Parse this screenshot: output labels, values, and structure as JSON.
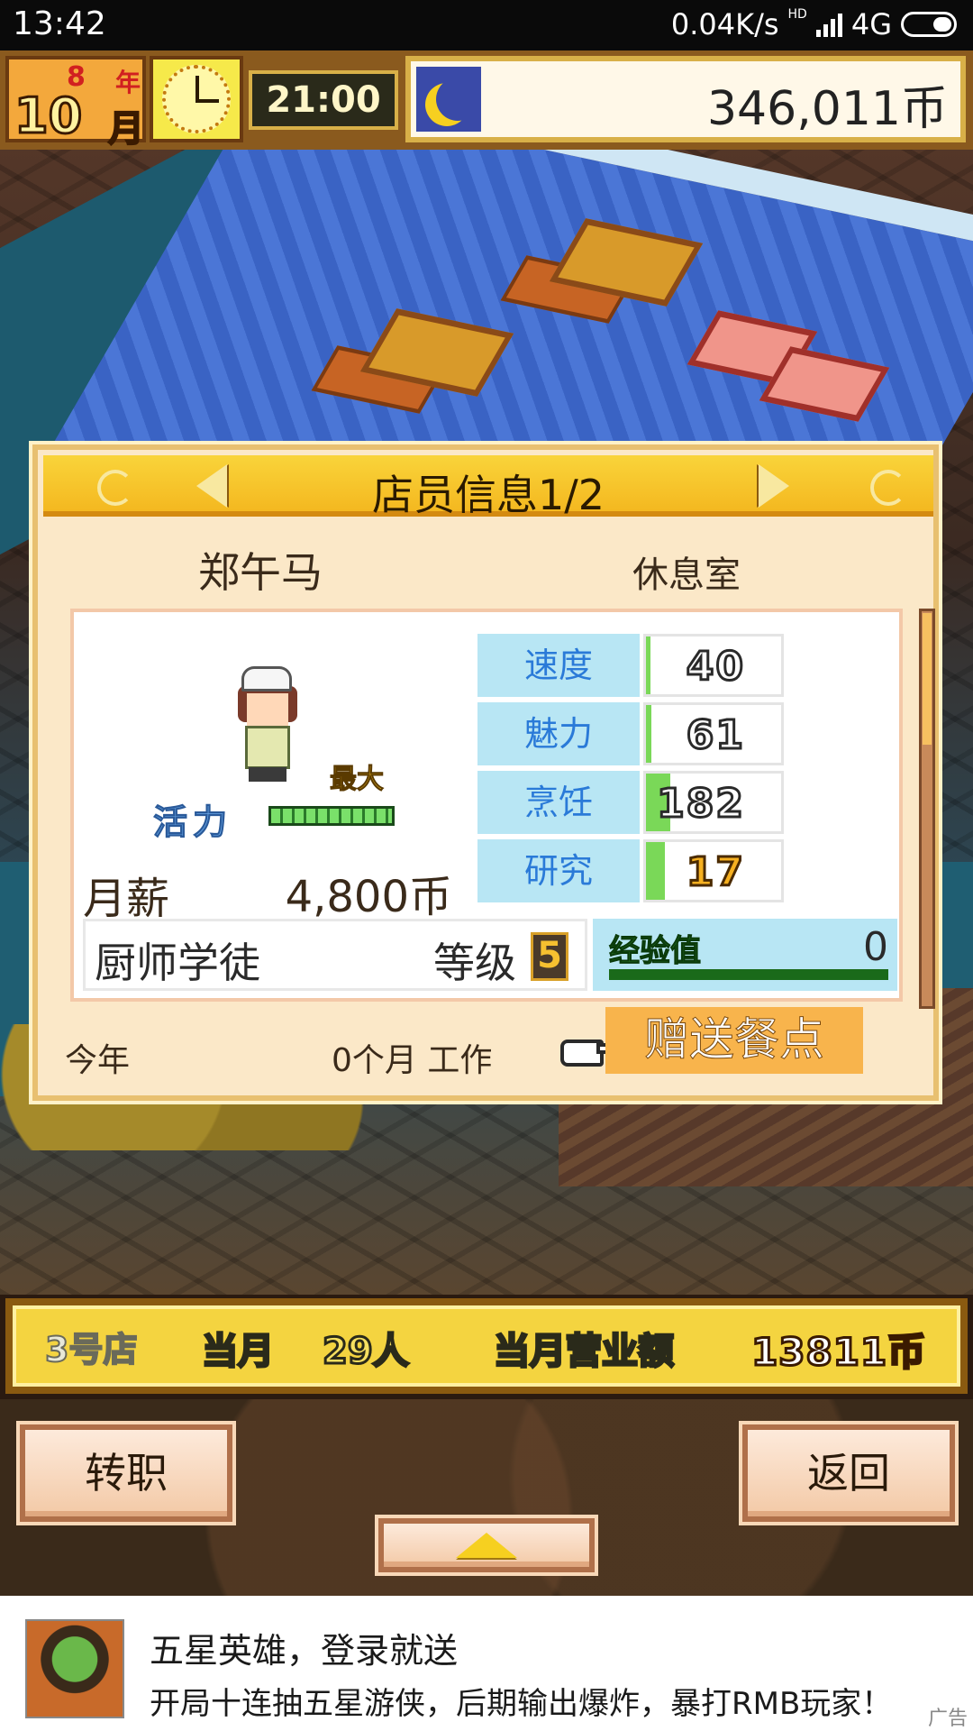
{
  "status_bar": {
    "time": "13:42",
    "network_speed": "0.04K/s",
    "hd_label": "HD",
    "network_type": "4G"
  },
  "hud": {
    "year": "8",
    "year_unit": "年",
    "month": "10",
    "month_unit": "月",
    "clock_time": "21:00",
    "money": "346,011币",
    "icons": [
      "clock-icon",
      "moon-icon"
    ]
  },
  "dialog": {
    "title": "店员信息1/2",
    "staff_name": "郑午马",
    "room": "休息室",
    "vital_label": "活力",
    "vital_max_label": "最大",
    "vital_fill": 1.0,
    "salary_label": "月薪",
    "salary_value": "4,800币",
    "stats": [
      {
        "name": "速度",
        "value": "40",
        "gauge": 0.02
      },
      {
        "name": "魅力",
        "value": "61",
        "gauge": 0.04
      },
      {
        "name": "烹饪",
        "value": "182",
        "gauge": 0.18
      },
      {
        "name": "研究",
        "value": "17",
        "gauge": 0.14
      }
    ],
    "job": "厨师学徒",
    "level_label": "等级",
    "level_value": "5",
    "exp_label": "经验值",
    "exp_value": "0",
    "footer_year": "今年",
    "footer_work": "0个月 工作",
    "gift_button": "赠送餐点"
  },
  "store_bar": {
    "store_name": "3号店",
    "month_label": "当月",
    "guests": "29人",
    "sales_label": "当月营业额",
    "sales_value": "13811币"
  },
  "controls": {
    "transfer_button": "转职",
    "back_button": "返回"
  },
  "ad": {
    "title": "五星英雄，登录就送",
    "description": "开局十连抽五星游侠，后期输出爆炸，暴打RMB玩家！",
    "tag": "广告"
  },
  "colors": {
    "header_gold": "#f4b820",
    "stat_name_bg": "#b8e6f4",
    "stat_name_text": "#2a7ad8",
    "gauge_green": "#7ad858",
    "gift_button_bg": "#f8b44c"
  }
}
